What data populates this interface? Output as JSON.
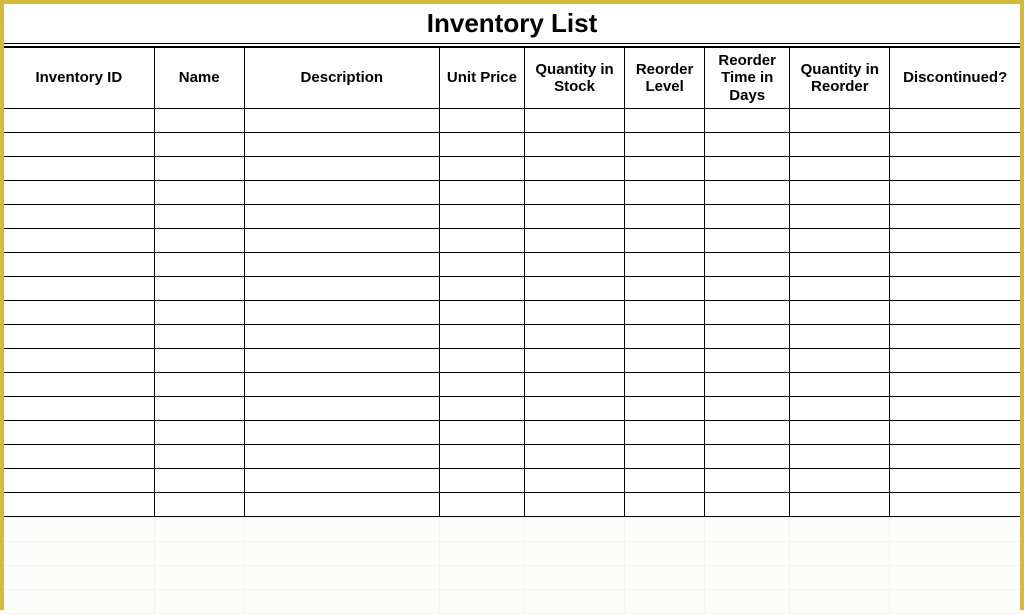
{
  "title": "Inventory List",
  "columns": [
    "Inventory ID",
    "Name",
    "Description",
    "Unit Price",
    "Quantity in Stock",
    "Reorder Level",
    "Reorder Time in Days",
    "Quantity in Reorder",
    "Discontinued?"
  ],
  "rows": [
    [
      "",
      "",
      "",
      "",
      "",
      "",
      "",
      "",
      ""
    ],
    [
      "",
      "",
      "",
      "",
      "",
      "",
      "",
      "",
      ""
    ],
    [
      "",
      "",
      "",
      "",
      "",
      "",
      "",
      "",
      ""
    ],
    [
      "",
      "",
      "",
      "",
      "",
      "",
      "",
      "",
      ""
    ],
    [
      "",
      "",
      "",
      "",
      "",
      "",
      "",
      "",
      ""
    ],
    [
      "",
      "",
      "",
      "",
      "",
      "",
      "",
      "",
      ""
    ],
    [
      "",
      "",
      "",
      "",
      "",
      "",
      "",
      "",
      ""
    ],
    [
      "",
      "",
      "",
      "",
      "",
      "",
      "",
      "",
      ""
    ],
    [
      "",
      "",
      "",
      "",
      "",
      "",
      "",
      "",
      ""
    ],
    [
      "",
      "",
      "",
      "",
      "",
      "",
      "",
      "",
      ""
    ],
    [
      "",
      "",
      "",
      "",
      "",
      "",
      "",
      "",
      ""
    ],
    [
      "",
      "",
      "",
      "",
      "",
      "",
      "",
      "",
      ""
    ],
    [
      "",
      "",
      "",
      "",
      "",
      "",
      "",
      "",
      ""
    ],
    [
      "",
      "",
      "",
      "",
      "",
      "",
      "",
      "",
      ""
    ],
    [
      "",
      "",
      "",
      "",
      "",
      "",
      "",
      "",
      ""
    ],
    [
      "",
      "",
      "",
      "",
      "",
      "",
      "",
      "",
      ""
    ],
    [
      "",
      "",
      "",
      "",
      "",
      "",
      "",
      "",
      ""
    ]
  ],
  "ghost_rows": 4
}
